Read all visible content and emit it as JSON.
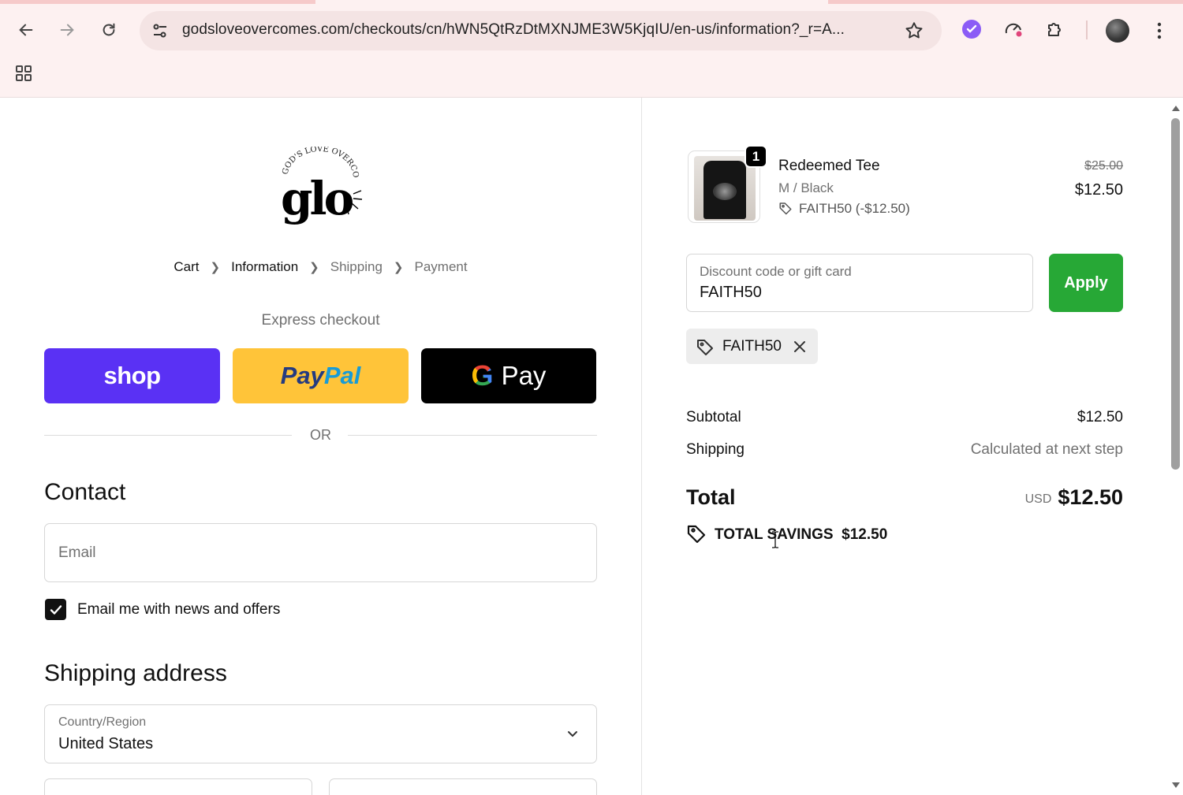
{
  "browser": {
    "url": "godsloveovercomes.com/checkouts/cn/hWN5QtRzDtMXNJME3W5KjqIU/en-us/information?_r=A...",
    "icons": [
      "back-icon",
      "forward-icon",
      "reload-icon",
      "site-settings-icon",
      "bookmark-star-icon",
      "extension-icon",
      "puzzle-icon",
      "profile-avatar",
      "more-icon",
      "apps-icon"
    ]
  },
  "breadcrumb": {
    "cart": "Cart",
    "information": "Information",
    "shipping": "Shipping",
    "payment": "Payment"
  },
  "express": {
    "title": "Express checkout",
    "shop_label": "shop",
    "paypal_a": "Pay",
    "paypal_b": "Pal",
    "gpay_label": "Pay",
    "or": "OR"
  },
  "contact": {
    "heading": "Contact",
    "email_placeholder": "Email",
    "newsletter_label": "Email me with news and offers",
    "newsletter_checked": true
  },
  "shipping_address": {
    "heading": "Shipping address",
    "country_label": "Country/Region",
    "country_value": "United States"
  },
  "summary": {
    "item": {
      "quantity": "1",
      "name": "Redeemed Tee",
      "variant": "M / Black",
      "discount": "FAITH50 (-$12.50)",
      "price_original": "$25.00",
      "price_final": "$12.50"
    },
    "discount_field": {
      "label": "Discount code or gift card",
      "value": "FAITH50",
      "apply_label": "Apply"
    },
    "applied_code": "FAITH50",
    "subtotal_label": "Subtotal",
    "subtotal_value": "$12.50",
    "shipping_label": "Shipping",
    "shipping_value": "Calculated at next step",
    "total_label": "Total",
    "total_currency": "USD",
    "total_value": "$12.50",
    "savings_label": "TOTAL SAVINGS",
    "savings_value": "$12.50"
  },
  "colors": {
    "shop": "#5a31f4",
    "paypal": "#ffc439",
    "apply": "#27a836",
    "chrome": "#fdf1f1"
  }
}
